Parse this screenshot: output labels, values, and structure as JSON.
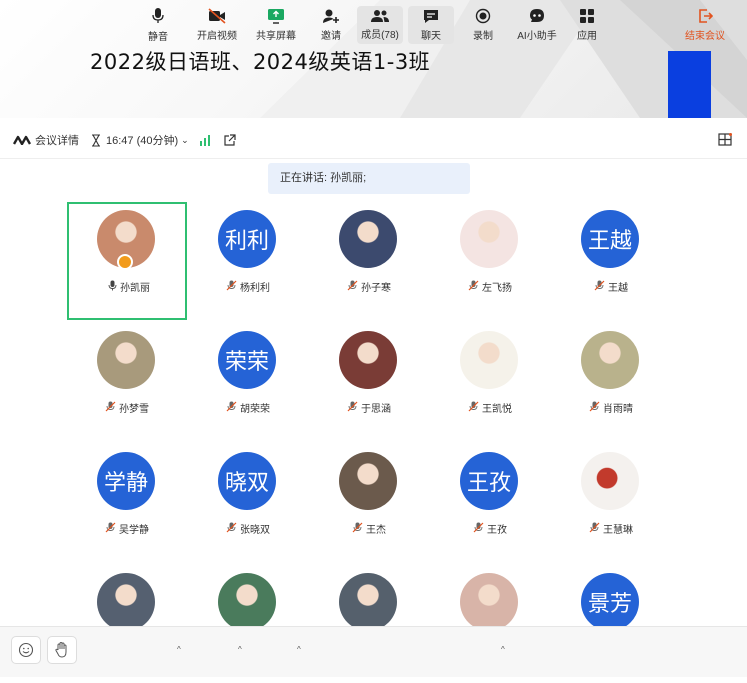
{
  "banner": {
    "title": "2022级日语班、2024级英语1-3班"
  },
  "topbar": {
    "meeting_details": "会议详情",
    "time": "16:47 (40分钟)",
    "caret": "⌄"
  },
  "speaking": "正在讲话: 孙凯丽;",
  "participants": [
    {
      "name": "孙凯丽",
      "type": "photo",
      "color": "#c98a6c",
      "mic": "on",
      "active": true,
      "host": true
    },
    {
      "name": "杨利利",
      "type": "text",
      "text": "利利",
      "mic": "off"
    },
    {
      "name": "孙子寒",
      "type": "photo",
      "color": "#3c4a6e",
      "mic": "off"
    },
    {
      "name": "左飞扬",
      "type": "photo",
      "color": "#f4e4e2",
      "mic": "off"
    },
    {
      "name": "王越",
      "type": "text",
      "text": "王越",
      "mic": "off"
    },
    {
      "name": "孙梦雪",
      "type": "photo",
      "color": "#a89a7c",
      "mic": "off"
    },
    {
      "name": "胡荣荣",
      "type": "text",
      "text": "荣荣",
      "mic": "off"
    },
    {
      "name": "于思涵",
      "type": "photo",
      "color": "#7a3c36",
      "mic": "off"
    },
    {
      "name": "王凯悦",
      "type": "photo",
      "color": "#f5f2ea",
      "mic": "off"
    },
    {
      "name": "肖雨晴",
      "type": "photo",
      "color": "#b9b28c",
      "mic": "off"
    },
    {
      "name": "吴学静",
      "type": "text",
      "text": "学静",
      "mic": "off"
    },
    {
      "name": "张晓双",
      "type": "text",
      "text": "晓双",
      "mic": "off"
    },
    {
      "name": "王杰",
      "type": "photo",
      "color": "#6b5a4c",
      "mic": "off"
    },
    {
      "name": "王孜",
      "type": "text",
      "text": "王孜",
      "mic": "off"
    },
    {
      "name": "王慧琳",
      "type": "photo",
      "color": "#ffffff",
      "mic": "off"
    },
    {
      "name": "",
      "type": "photo",
      "color": "#556070",
      "mic": "off"
    },
    {
      "name": "",
      "type": "photo",
      "color": "#4a7b5c",
      "mic": "off"
    },
    {
      "name": "",
      "type": "photo",
      "color": "#55606c",
      "mic": "off"
    },
    {
      "name": "",
      "type": "photo",
      "color": "#d8b4a8",
      "mic": "off"
    },
    {
      "name": "",
      "type": "text",
      "text": "景芳",
      "mic": "off"
    }
  ],
  "toolbar": {
    "mute": "静音",
    "video": "开启视频",
    "share": "共享屏幕",
    "invite": "邀请",
    "members": "成员(78)",
    "chat": "聊天",
    "record": "录制",
    "ai": "AI小助手",
    "apps": "应用",
    "end": "结束会议"
  },
  "colors": {
    "accent": "#2563d6",
    "active_border": "#2fbf71",
    "end": "#e2531f",
    "banner_blue": "#0a3fe0"
  }
}
